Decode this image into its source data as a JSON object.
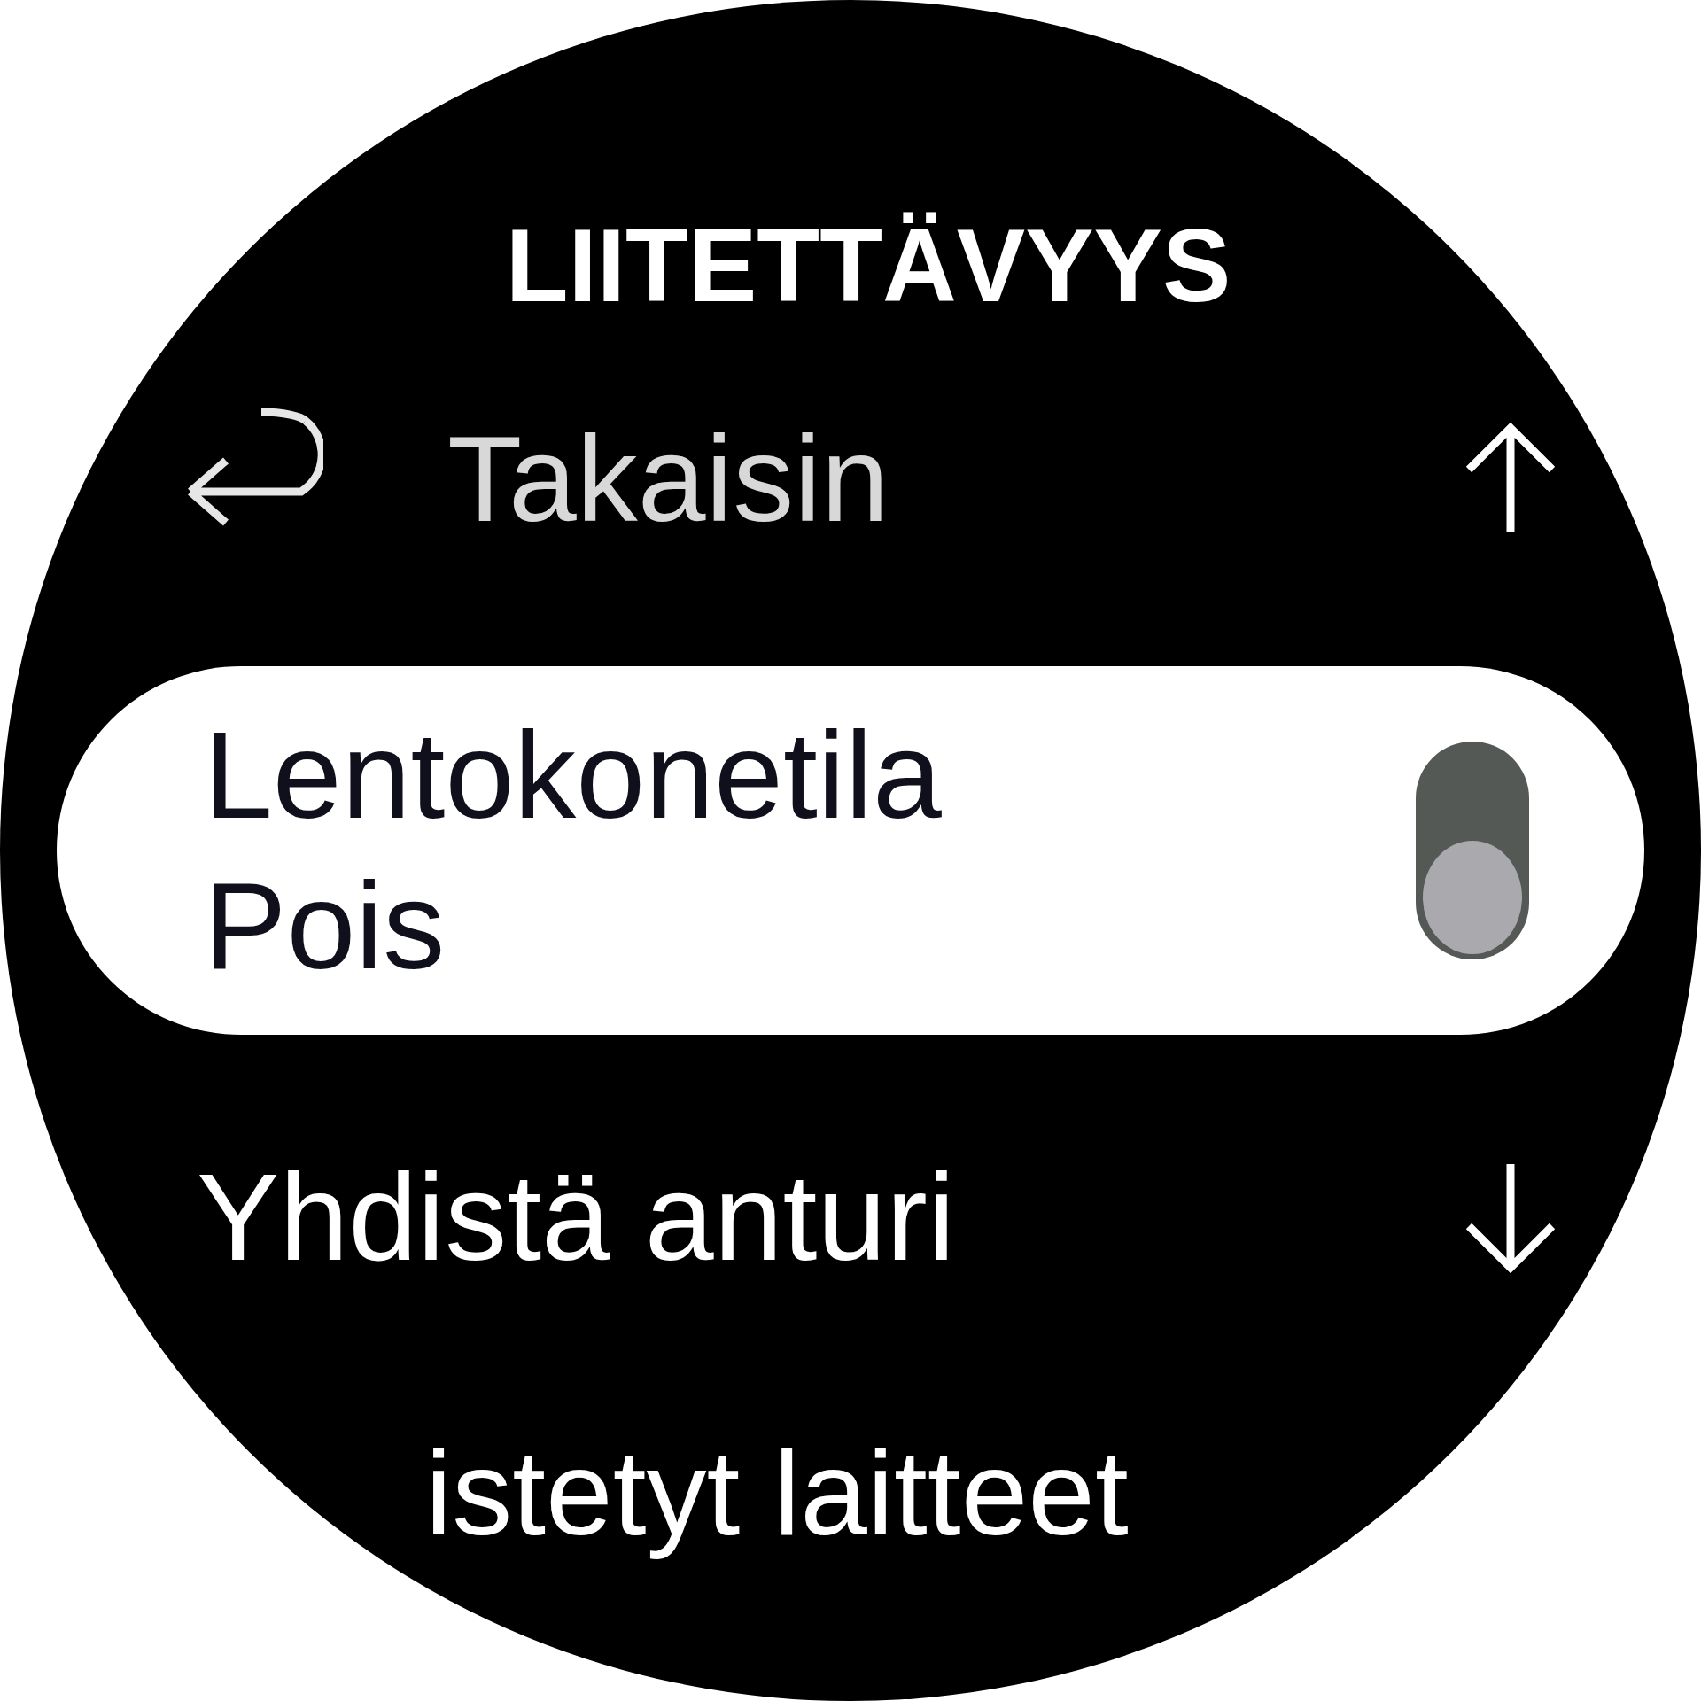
{
  "title": "LIITETTÄVYYS",
  "back": {
    "label": "Takaisin"
  },
  "setting": {
    "label": "Lentokonetila",
    "value": "Pois",
    "on": false,
    "selected": true
  },
  "next": {
    "label": "Yhdistä anturi"
  },
  "partial": {
    "label": "istetyt laitteet"
  }
}
